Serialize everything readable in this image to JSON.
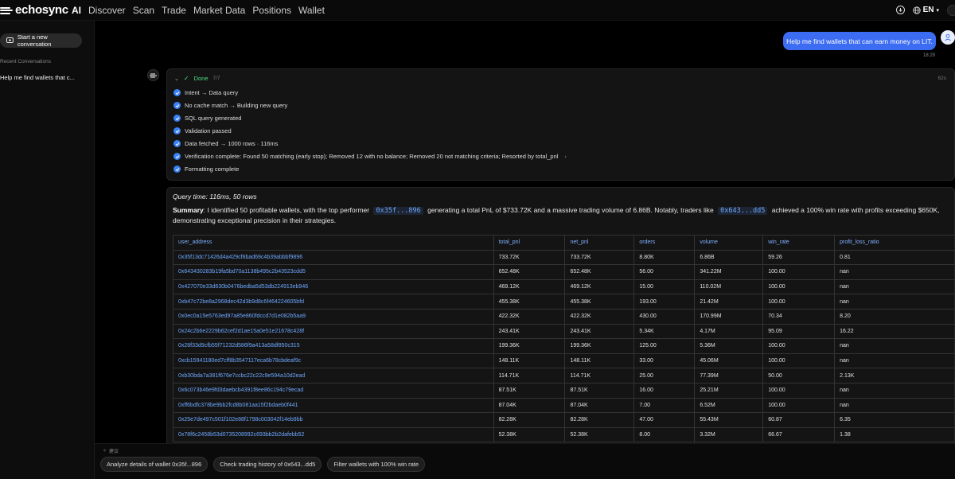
{
  "brand": {
    "name": "echosync"
  },
  "nav": [
    {
      "label": "AI",
      "active": true
    },
    {
      "label": "Discover",
      "active": false
    },
    {
      "label": "Scan",
      "active": false
    },
    {
      "label": "Trade",
      "active": false
    },
    {
      "label": "Market Data",
      "active": false
    },
    {
      "label": "Positions",
      "active": false
    },
    {
      "label": "Wallet",
      "active": false
    }
  ],
  "topright": {
    "lang": "EN"
  },
  "sidebar": {
    "new_conversation": "Start a new conversation",
    "recent_label": "Recent Conversations",
    "recent_items": [
      "Help me find wallets that c..."
    ]
  },
  "chat": {
    "user_message": "Help me find wallets that can earn money on LIT.",
    "user_time": "18:29",
    "steps_status": "Done",
    "steps_count": "7/7",
    "steps_duration": "62s",
    "steps": [
      "Intent → Data query",
      "No cache match → Building new query",
      "SQL query generated",
      "Validation passed",
      "Data fetched → 1000 rows · 116ms",
      "Verification complete: Found 50 matching (early stop); Removed 12 with no balance; Removed 20 not matching criteria; Resorted by total_pnl",
      "Formatting complete"
    ],
    "query_time": "Query time: 116ms, 50 rows",
    "summary": {
      "label": "Summary",
      "part1": ": I identified 50 profitable wallets, with the top performer",
      "addr1": "0x35f...896",
      "part2": "generating a total PnL of $733.72K and a massive trading volume of 6.86B. Notably, traders like",
      "addr2": "0x643...dd5",
      "part3": "achieved a 100% win rate with profits exceeding $650K, demonstrating exceptional precision in their strategies."
    }
  },
  "table": {
    "columns": [
      "user_address",
      "total_pnl",
      "net_pnl",
      "orders",
      "volume",
      "win_rate",
      "profit_loss_ratio"
    ],
    "rows": [
      [
        "0x35f13dc71426d4a429cf8bad69c4b39abbbf9896",
        "733.72K",
        "733.72K",
        "8.80K",
        "6.86B",
        "59.26",
        "0.81"
      ],
      [
        "0x643430283b19fa5bd70a1138b495c2b43523cdd5",
        "652.48K",
        "652.48K",
        "56.00",
        "341.22M",
        "100.00",
        "nan"
      ],
      [
        "0x427070e33d630b0476bedba5d53db224913eb946",
        "469.12K",
        "469.12K",
        "15.00",
        "110.02M",
        "100.00",
        "nan"
      ],
      [
        "0xb47c72be8a2968dec42d3b9d8c6f464224605bfd",
        "455.38K",
        "455.38K",
        "193.00",
        "21.42M",
        "100.00",
        "nan"
      ],
      [
        "0x0ec0a15e5763ed97a85e860fdccd7d1e082b5aa9",
        "422.32K",
        "422.32K",
        "430.00",
        "170.99M",
        "70.34",
        "8.20"
      ],
      [
        "0x24c2b6e2229b62cef2d1ae15a0e51e21678c428f",
        "243.41K",
        "243.41K",
        "5.34K",
        "4.17M",
        "95.09",
        "16.22"
      ],
      [
        "0x28f33d9cfb55f71232d586f9a413a58df850c315",
        "199.36K",
        "199.36K",
        "125.00",
        "5.36M",
        "100.00",
        "nan"
      ],
      [
        "0xcb15941180ed7cff8b3547117eca6b78cbdeaf9c",
        "148.11K",
        "148.11K",
        "33.00",
        "45.06M",
        "100.00",
        "nan"
      ],
      [
        "0xb30bda7a381f676e7ccbc22c22c9e594a10d2ead",
        "114.71K",
        "114.71K",
        "25.00",
        "77.39M",
        "50.00",
        "2.13K"
      ],
      [
        "0x6c073b46e9fd3daebcb4391f8ee86c194c79ecad",
        "87.51K",
        "87.51K",
        "16.00",
        "25.21M",
        "100.00",
        "nan"
      ],
      [
        "0xff6bdfc378be9bb2fcd8b081aa15f2bdaeb0f441",
        "87.04K",
        "87.04K",
        "7.00",
        "6.52M",
        "100.00",
        "nan"
      ],
      [
        "0x25e7de497c501f102e88f1798c003042f14eb9bb",
        "82.28K",
        "82.28K",
        "47.00",
        "55.43M",
        "60.87",
        "6.35"
      ],
      [
        "0x78f6c2458b53d0735208992c693bb2b2dafebb52",
        "52.38K",
        "52.38K",
        "8.00",
        "3.32M",
        "66.67",
        "1.38"
      ]
    ]
  },
  "suggestions": {
    "label": "建议",
    "items": [
      "Analyze details of wallet 0x35f...896",
      "Check trading history of 0x643...dd5",
      "Filter wallets with 100% win rate"
    ]
  }
}
